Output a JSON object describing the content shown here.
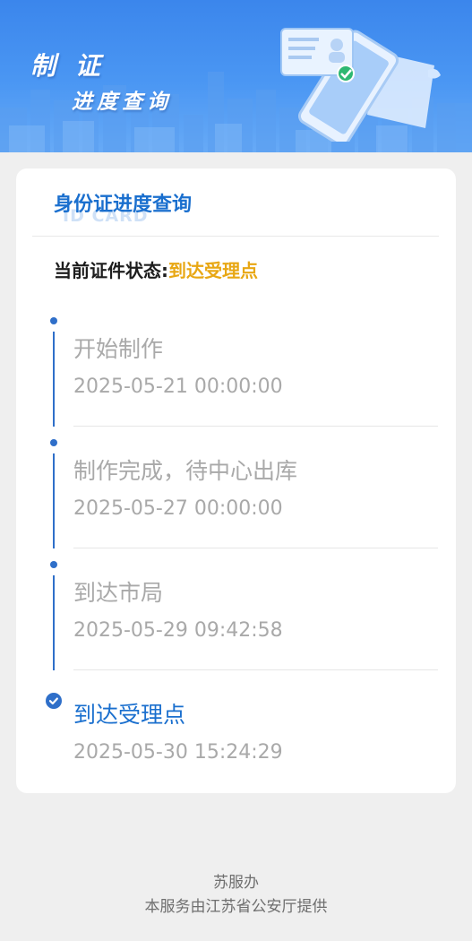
{
  "banner": {
    "title": "制 证",
    "subtitle": "进度查询"
  },
  "card": {
    "title": "身份证进度查询",
    "watermark": "ID CARD",
    "status_label": "当前证件状态:",
    "status_value": "到达受理点"
  },
  "steps": [
    {
      "title": "开始制作",
      "time": "2025-05-21 00:00:00"
    },
    {
      "title": "制作完成，待中心出库",
      "time": "2025-05-27 00:00:00"
    },
    {
      "title": "到达市局",
      "time": "2025-05-29 09:42:58"
    },
    {
      "title": "到达受理点",
      "time": "2025-05-30 15:24:29"
    }
  ],
  "footer": {
    "line1": "苏服办",
    "line2": "本服务由江苏省公安厅提供"
  },
  "colors": {
    "banner_blue": "#3b86ec",
    "accent_blue": "#1a6fce",
    "status_yellow": "#e8a713",
    "muted_gray": "#a9a9a9"
  }
}
